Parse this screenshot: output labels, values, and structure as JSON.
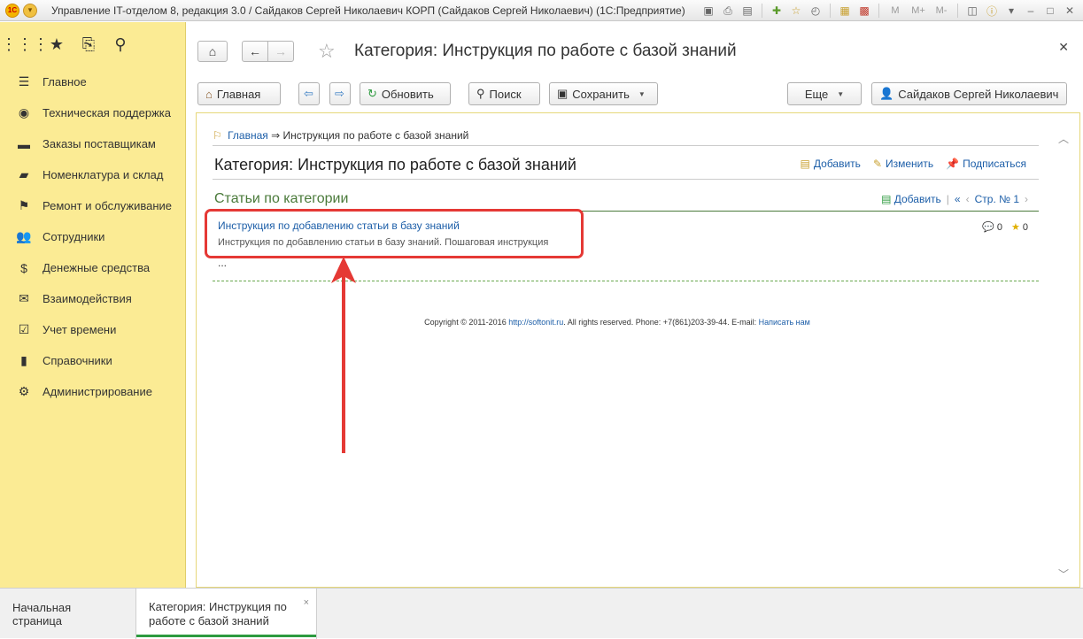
{
  "titlebar": {
    "title": "Управление IT-отделом 8, редакция 3.0 / Сайдаков Сергей Николаевич КОРП (Сайдаков Сергей Николаевич)  (1С:Предприятие)",
    "logo_text": "1С",
    "memory_buttons": [
      "M",
      "M+",
      "M-"
    ]
  },
  "sidebar": {
    "items": [
      {
        "label": "Главное",
        "icon": "menu-icon"
      },
      {
        "label": "Техническая поддержка",
        "icon": "support-icon"
      },
      {
        "label": "Заказы поставщикам",
        "icon": "truck-icon"
      },
      {
        "label": "Номенклатура и склад",
        "icon": "warehouse-icon"
      },
      {
        "label": "Ремонт и обслуживание",
        "icon": "checkered-flag-icon"
      },
      {
        "label": "Сотрудники",
        "icon": "people-icon"
      },
      {
        "label": "Денежные средства",
        "icon": "money-bag-icon"
      },
      {
        "label": "Взаимодействия",
        "icon": "envelope-icon"
      },
      {
        "label": "Учет времени",
        "icon": "calendar-check-icon"
      },
      {
        "label": "Справочники",
        "icon": "books-icon"
      },
      {
        "label": "Администрирование",
        "icon": "gear-icon"
      }
    ]
  },
  "window": {
    "title": "Категория: Инструкция по работе с базой знаний"
  },
  "toolbar": {
    "home": "Главная",
    "refresh": "Обновить",
    "search": "Поиск",
    "save": "Сохранить",
    "more": "Еще",
    "user": "Сайдаков Сергей Николаевич"
  },
  "content": {
    "breadcrumb_link": "Главная",
    "breadcrumb_current": "⇒ Инструкция по работе с базой знаний",
    "category_title": "Категория: Инструкция по работе с базой знаний",
    "actions": {
      "add": "Добавить",
      "edit": "Изменить",
      "subscribe": "Подписаться"
    },
    "section_title": "Статьи по категории",
    "section_add": "Добавить",
    "pager_first": "«",
    "pager_prev": "‹",
    "pager_page": "Стр. № 1",
    "pager_next": "›",
    "article": {
      "title": "Инструкция по добавлению статьи в базу знаний",
      "description": "Инструкция по добавлению статьи в базу знаний. Пошаговая инструкция",
      "comments": "0",
      "rating": "0"
    },
    "more": "...",
    "footer": {
      "copyright": "Copyright © 2011-2016 ",
      "site": "http://softonit.ru",
      "rest": ". All rights reserved. Phone: +7(861)203-39-44. E-mail: ",
      "email_link": "Написать нам"
    }
  },
  "tabs": {
    "home": "Начальная страница",
    "active_line1": "Категория: Инструкция по",
    "active_line2": "работе с базой знаний"
  },
  "colors": {
    "sidebar_bg": "#fbeb94",
    "link_blue": "#1c5ea8",
    "section_green": "#4a7a3a",
    "highlight_red": "#e53935",
    "active_tab_bar": "#2d9a3f"
  }
}
